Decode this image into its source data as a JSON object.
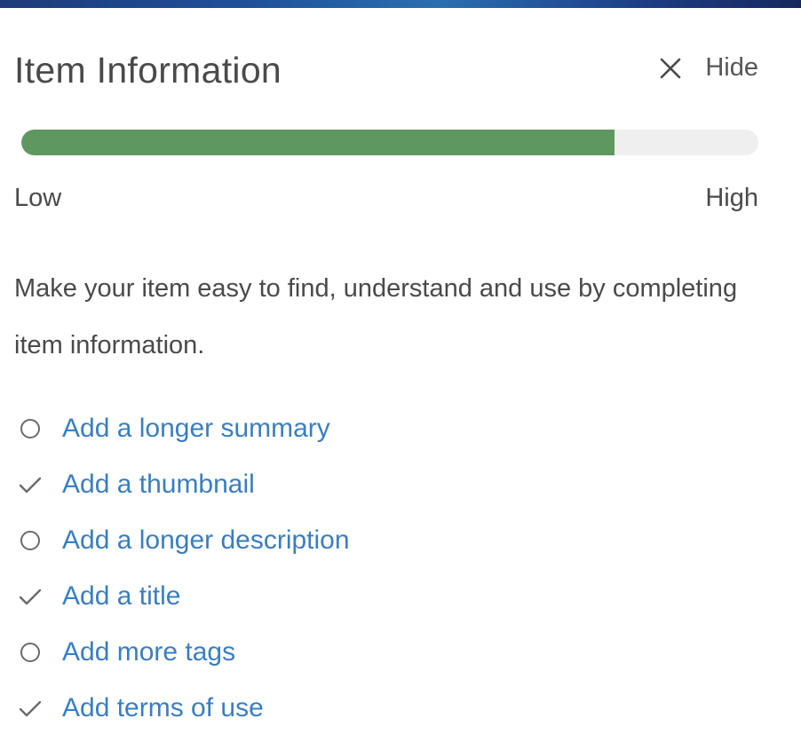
{
  "header": {
    "title": "Item Information",
    "hide_label": "Hide"
  },
  "progress": {
    "value_percent": 80.5,
    "fill_color": "#5f9761",
    "low_label": "Low",
    "high_label": "High"
  },
  "description": "Make your item easy to find, understand and use by completing item information.",
  "checklist": [
    {
      "label": "Add a longer summary",
      "status": "incomplete",
      "icon": "circle-icon"
    },
    {
      "label": "Add a thumbnail",
      "status": "complete",
      "icon": "check-icon"
    },
    {
      "label": "Add a longer description",
      "status": "incomplete",
      "icon": "circle-icon"
    },
    {
      "label": "Add a title",
      "status": "complete",
      "icon": "check-icon"
    },
    {
      "label": "Add more tags",
      "status": "incomplete",
      "icon": "circle-icon"
    },
    {
      "label": "Add terms of use",
      "status": "complete",
      "icon": "check-icon"
    }
  ],
  "colors": {
    "link": "#3a7ec0",
    "text": "#4a4a4a",
    "progress_track": "#efefef"
  }
}
